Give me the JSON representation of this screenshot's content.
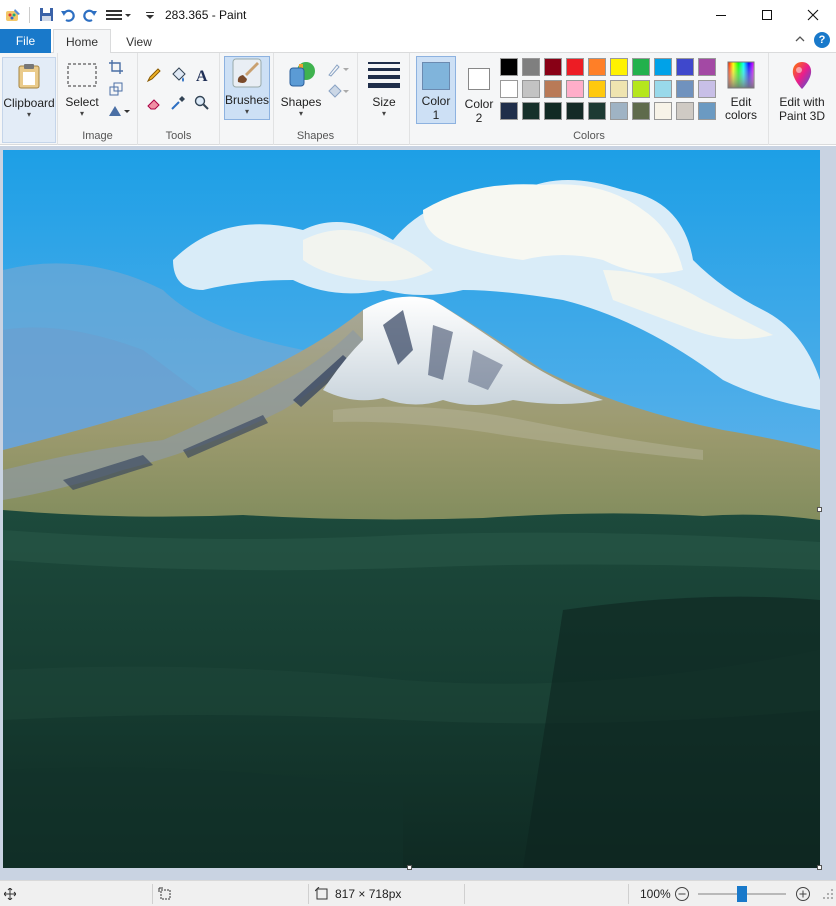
{
  "window": {
    "title": "283.365 - Paint",
    "minimize_icon": "minimize-icon",
    "maximize_icon": "maximize-icon",
    "close_icon": "close-icon"
  },
  "tabs": {
    "file": "File",
    "home": "Home",
    "view": "View"
  },
  "ribbon": {
    "clipboard": "Clipboard",
    "select": "Select",
    "image_group": "Image",
    "tools_group": "Tools",
    "brushes": "Brushes",
    "shapes": "Shapes",
    "shapes_group": "Shapes",
    "size": "Size",
    "color1_line1": "Color",
    "color1_line2": "1",
    "color2_line1": "Color",
    "color2_line2": "2",
    "colors_group": "Colors",
    "edit_colors_line1": "Edit",
    "edit_colors_line2": "colors",
    "paint3d_line1": "Edit with",
    "paint3d_line2": "Paint 3D"
  },
  "colors": {
    "color1": "#80b4db",
    "color2": "#ffffff",
    "palette": [
      [
        "#000000",
        "#7f7f7f",
        "#880015",
        "#ed1c24",
        "#ff7f27",
        "#fff200",
        "#22b14c",
        "#00a2e8",
        "#3f48cc",
        "#a349a4"
      ],
      [
        "#ffffff",
        "#c3c3c3",
        "#b97a57",
        "#ffaec9",
        "#ffc90e",
        "#efe4b0",
        "#b5e61d",
        "#99d9ea",
        "#7092be",
        "#c8bfe7"
      ],
      [
        "#1f2e4a",
        "#16302a",
        "#112a24",
        "#142a26",
        "#1d3a33",
        "#9fb3c4",
        "#5f6b4c",
        "#f7f3e8",
        "#cfcac4",
        "#6b9ac2"
      ]
    ]
  },
  "status": {
    "image_size": "817 × 718px",
    "zoom": "100%",
    "zoom_level": 0.5
  }
}
